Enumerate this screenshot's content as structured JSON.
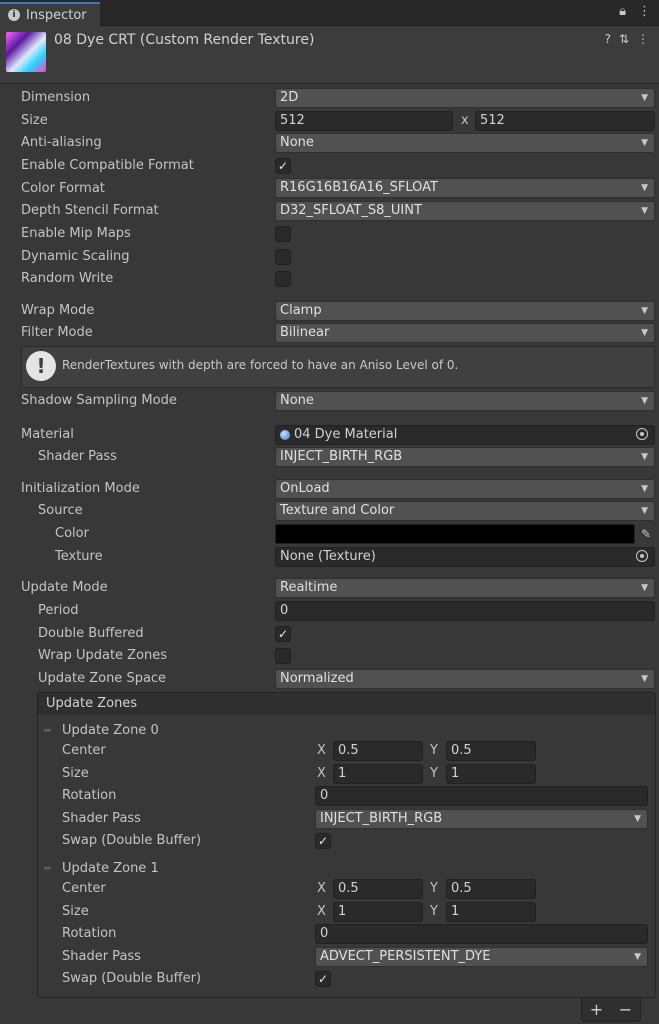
{
  "tab": {
    "label": "Inspector"
  },
  "asset": {
    "title": "08 Dye CRT (Custom Render Texture)"
  },
  "props": {
    "dimension": {
      "label": "Dimension",
      "value": "2D"
    },
    "size": {
      "label": "Size",
      "w": "512",
      "x": "x",
      "h": "512"
    },
    "antialiasing": {
      "label": "Anti-aliasing",
      "value": "None"
    },
    "compat": {
      "label": "Enable Compatible Format",
      "checked": true
    },
    "color_format": {
      "label": "Color Format",
      "value": "R16G16B16A16_SFLOAT"
    },
    "depth_format": {
      "label": "Depth Stencil Format",
      "value": "D32_SFLOAT_S8_UINT"
    },
    "mipmaps": {
      "label": "Enable Mip Maps",
      "checked": false
    },
    "dynscale": {
      "label": "Dynamic Scaling",
      "checked": false
    },
    "randwrite": {
      "label": "Random Write",
      "checked": false
    },
    "wrap": {
      "label": "Wrap Mode",
      "value": "Clamp"
    },
    "filter": {
      "label": "Filter Mode",
      "value": "Bilinear"
    },
    "help": "RenderTextures with depth are forced to have an Aniso Level of 0.",
    "shadow": {
      "label": "Shadow Sampling Mode",
      "value": "None"
    },
    "material": {
      "label": "Material",
      "value": "04 Dye Material"
    },
    "shaderpass": {
      "label": "Shader Pass",
      "value": "INJECT_BIRTH_RGB"
    },
    "initmode": {
      "label": "Initialization Mode",
      "value": "OnLoad"
    },
    "source": {
      "label": "Source",
      "value": "Texture and Color"
    },
    "color": {
      "label": "Color",
      "value": "#000000"
    },
    "texture": {
      "label": "Texture",
      "value": "None (Texture)"
    },
    "updatemode": {
      "label": "Update Mode",
      "value": "Realtime"
    },
    "period": {
      "label": "Period",
      "value": "0"
    },
    "doublebuf": {
      "label": "Double Buffered",
      "checked": true
    },
    "wrapzones": {
      "label": "Wrap Update Zones",
      "checked": false
    },
    "zonespace": {
      "label": "Update Zone Space",
      "value": "Normalized"
    }
  },
  "zones": {
    "header": "Update Zones",
    "labels": {
      "center": "Center",
      "size": "Size",
      "rotation": "Rotation",
      "shaderpass": "Shader Pass",
      "swap": "Swap (Double Buffer)",
      "x": "X",
      "y": "Y"
    },
    "items": [
      {
        "name": "Update Zone 0",
        "cx": "0.5",
        "cy": "0.5",
        "sx": "1",
        "sy": "1",
        "rotation": "0",
        "pass": "INJECT_BIRTH_RGB",
        "swap": true
      },
      {
        "name": "Update Zone 1",
        "cx": "0.5",
        "cy": "0.5",
        "sx": "1",
        "sy": "1",
        "rotation": "0",
        "pass": "ADVECT_PERSISTENT_DYE",
        "swap": true
      }
    ]
  },
  "buttons": {
    "plus": "+",
    "minus": "−"
  }
}
